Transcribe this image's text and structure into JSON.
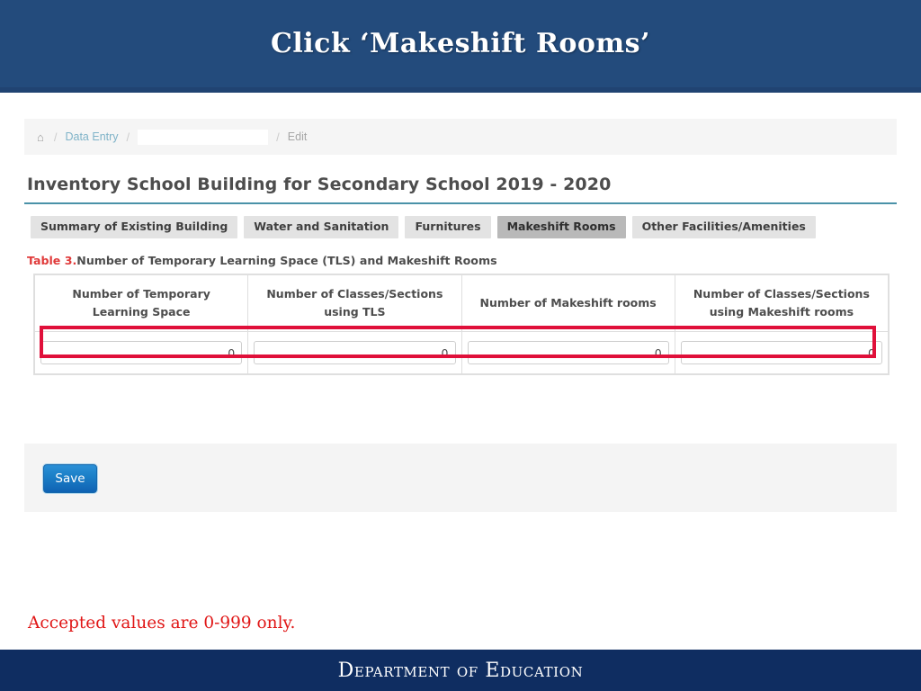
{
  "slide": {
    "title": "Click ‘Makeshift Rooms’",
    "note": "Accepted values are 0-999 only.",
    "footer": "Department of Education",
    "colors": {
      "header_navy": "#234b7c",
      "footer_navy": "#0f2d61",
      "note_red": "#e01616",
      "highlight_red": "#e0103a",
      "accent_teal": "#4a92a8",
      "save_blue": "#1b7fc7"
    }
  },
  "breadcrumb": {
    "home_icon": "home-icon",
    "separator": "/",
    "items": [
      {
        "label": "Data Entry",
        "type": "link"
      },
      {
        "label": "",
        "type": "redacted"
      },
      {
        "label": "Edit",
        "type": "current"
      }
    ]
  },
  "page": {
    "title": "Inventory School Building for Secondary School 2019 - 2020"
  },
  "tabs": [
    {
      "label": "Summary of Existing Building",
      "active": false
    },
    {
      "label": "Water and Sanitation",
      "active": false
    },
    {
      "label": "Furnitures",
      "active": false
    },
    {
      "label": "Makeshift Rooms",
      "active": true
    },
    {
      "label": "Other Facilities/Amenities",
      "active": false
    }
  ],
  "table": {
    "caption_label": "Table 3.",
    "caption_text": "Number of Temporary Learning Space (TLS) and Makeshift Rooms",
    "columns": [
      "Number of Temporary Learning Space",
      "Number of Classes/Sections using TLS",
      "Number of Makeshift rooms",
      "Number of Classes/Sections using Makeshift rooms"
    ],
    "columns_line1": [
      "Number of Temporary",
      "Number of Classes/Sections",
      "Number of Makeshift rooms",
      "Number of Classes/Sections"
    ],
    "columns_line2": [
      "Learning Space",
      "using TLS",
      "",
      "using Makeshift rooms"
    ],
    "values": [
      "0",
      "0",
      "0",
      "0"
    ],
    "placeholders": [
      "",
      "",
      "",
      ""
    ]
  },
  "actions": {
    "save_label": "Save"
  }
}
